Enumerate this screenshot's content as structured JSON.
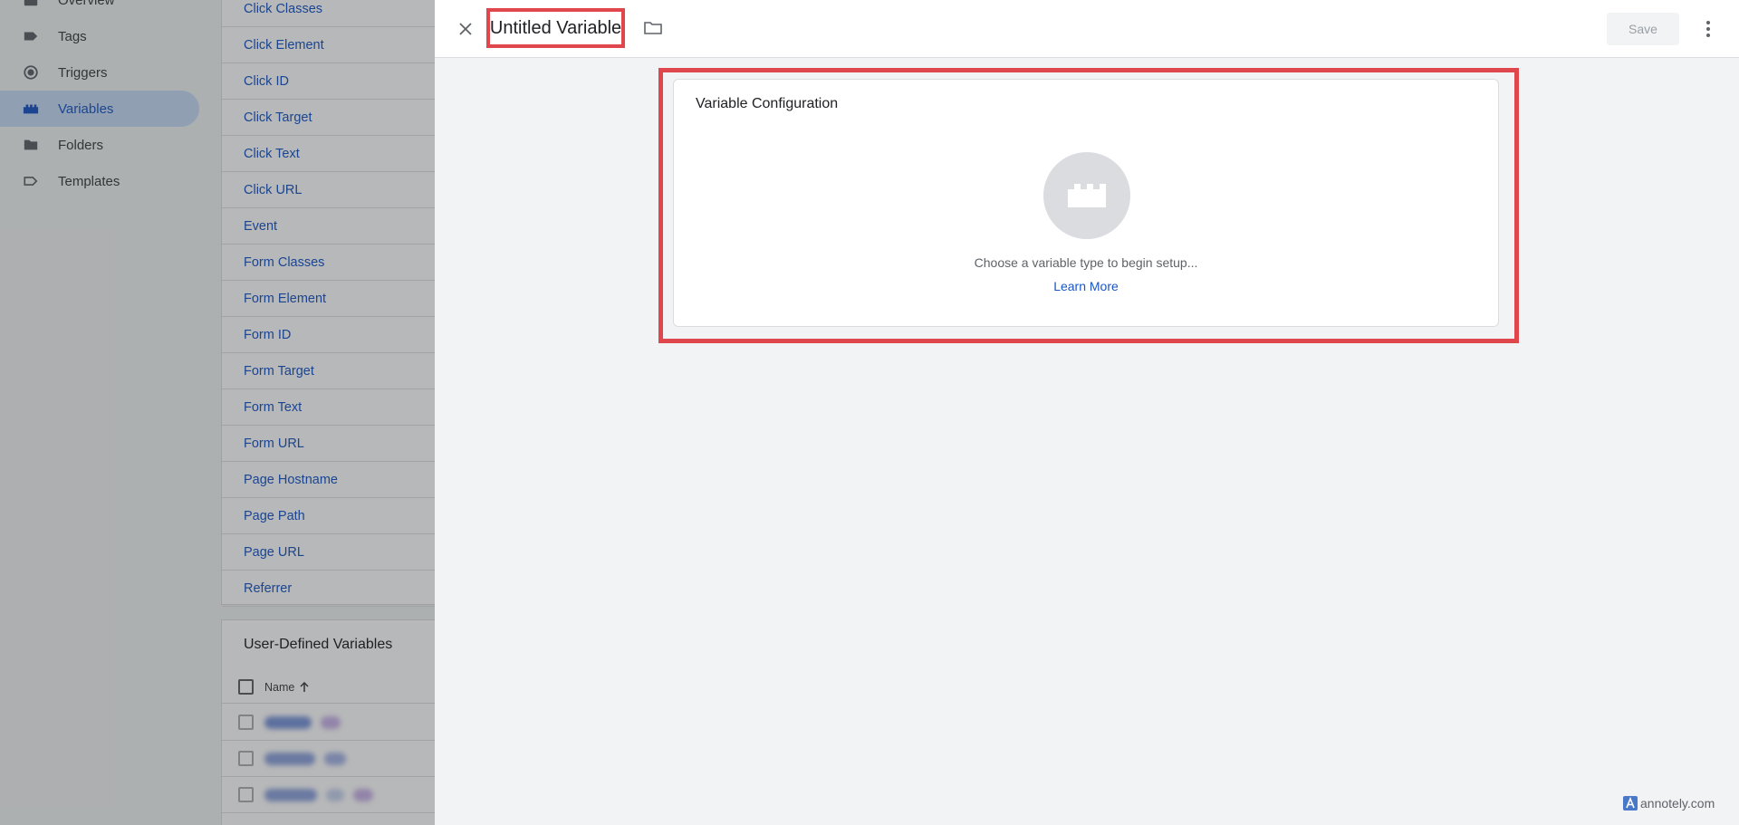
{
  "sidebar": {
    "items": [
      {
        "label": "Overview",
        "icon": "overview-icon",
        "active": false
      },
      {
        "label": "Tags",
        "icon": "tag-icon",
        "active": false
      },
      {
        "label": "Triggers",
        "icon": "trigger-icon",
        "active": false
      },
      {
        "label": "Variables",
        "icon": "variables-icon",
        "active": true
      },
      {
        "label": "Folders",
        "icon": "folder-icon",
        "active": false
      },
      {
        "label": "Templates",
        "icon": "template-icon",
        "active": false
      }
    ]
  },
  "builtin_variables": [
    "Click Classes",
    "Click Element",
    "Click ID",
    "Click Target",
    "Click Text",
    "Click URL",
    "Event",
    "Form Classes",
    "Form Element",
    "Form ID",
    "Form Target",
    "Form Text",
    "Form URL",
    "Page Hostname",
    "Page Path",
    "Page URL",
    "Referrer"
  ],
  "user_defined": {
    "title": "User-Defined Variables",
    "column_name": "Name"
  },
  "dialog": {
    "title": "Untitled Variable",
    "save_label": "Save",
    "config": {
      "title": "Variable Configuration",
      "hint": "Choose a variable type to begin setup...",
      "link": "Learn More"
    }
  },
  "watermark": "annotely.com",
  "colors": {
    "accent": "#1a56c4",
    "highlight": "#e0474c",
    "active_nav": "#c7dbf7"
  }
}
